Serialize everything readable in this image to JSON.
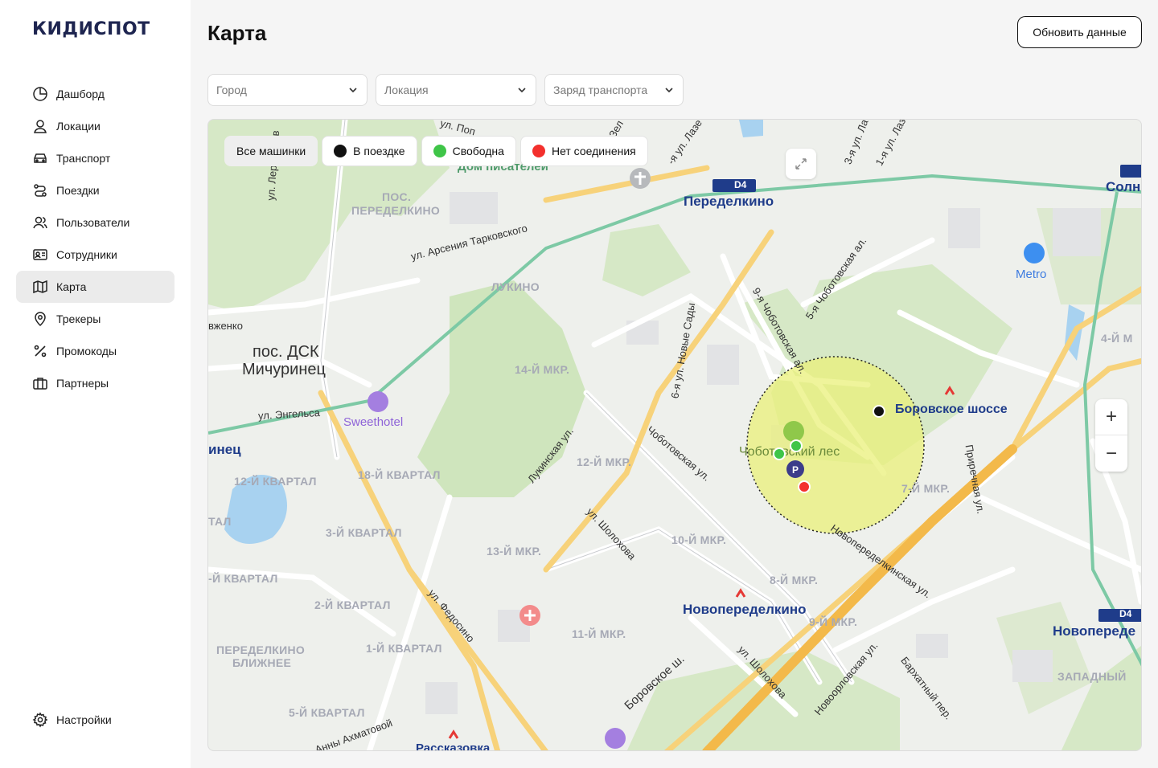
{
  "app": {
    "logo": "КИДИСПОТ"
  },
  "sidebar": {
    "items": [
      {
        "label": "Дашборд",
        "icon": "dashboard-icon"
      },
      {
        "label": "Локации",
        "icon": "location-user-icon"
      },
      {
        "label": "Транспорт",
        "icon": "car-icon"
      },
      {
        "label": "Поездки",
        "icon": "route-icon"
      },
      {
        "label": "Пользователи",
        "icon": "users-icon"
      },
      {
        "label": "Сотрудники",
        "icon": "id-card-icon"
      },
      {
        "label": "Карта",
        "icon": "map-icon",
        "active": true
      },
      {
        "label": "Трекеры",
        "icon": "pin-icon"
      },
      {
        "label": "Промокоды",
        "icon": "percent-icon"
      },
      {
        "label": "Партнеры",
        "icon": "briefcase-icon"
      }
    ],
    "settings": "Настройки"
  },
  "header": {
    "title": "Карта",
    "refresh_label": "Обновить данные"
  },
  "filters": {
    "city": "Город",
    "location": "Локация",
    "charge": "Заряд транспорта"
  },
  "legend": {
    "all": "Все машинки",
    "in_trip": "В поездке",
    "free": "Свободна",
    "no_connection": "Нет соединения"
  },
  "colors": {
    "in_trip": "#111111",
    "free": "#3fc548",
    "no_connection": "#f3302d",
    "geofence": "#e9f07a"
  },
  "map": {
    "places": {
      "peredelkino": "Переделкино",
      "novoperedelkino": "Новопеределкино",
      "novopered_right": "Новопереде",
      "borovskoe": "Боровское шоссе",
      "solnts": "Солн",
      "metro": "Metro",
      "sweethotel": "Sweethotel",
      "dom_pisateley": "Дом писателей",
      "mich_left": "инец",
      "rasskazovka": "Рассказовка",
      "chobot_forest": "Чоботовский лес",
      "d4": "D4"
    },
    "towns": {
      "dsk": "пос. ДСК",
      "dsk2": "Мичуринец"
    },
    "districts": {
      "pos_peredelkino": "ПОС.",
      "pos_peredelkino2": "ПЕРЕДЕЛКИНО",
      "lukino": "ЛУКИНО",
      "m14": "14-Й МКР.",
      "m12": "12-Й МКР.",
      "m13": "13-Й МКР.",
      "m10": "10-Й МКР.",
      "m11": "11-Й МКР.",
      "m8": "8-Й МКР.",
      "m9": "9-Й МКР.",
      "m7": "7-Й МКР.",
      "m4": "4-Й М",
      "q12": "12-Й КВАРТАЛ",
      "q18": "18-Й КВАРТАЛ",
      "q3": "3-Й КВАРТАЛ",
      "q2": "2-Й КВАРТАЛ",
      "q1": "1-Й КВАРТАЛ",
      "q5": "5-Й КВАРТАЛ",
      "q_left": "-Й КВАРТАЛ",
      "tal": "ТАЛ",
      "blizh1": "ПЕРЕДЕЛКИНО",
      "blizh2": "БЛИЖНЕЕ",
      "zapad": "ЗАПАДНЫЙ"
    },
    "streets": {
      "arseniya": "ул. Арсения Тарковского",
      "engelsa": "ул. Энгельса",
      "lermontov": "ул. Лермонтов",
      "lukinskaya": "Лукинская ул.",
      "chobotovskaya": "Чоботовская ул.",
      "sholokhova": "ул. Шолохова",
      "sholokhova2": "ул. Шолохова",
      "fedosino": "ул. Федосино",
      "borovskoe_sh": "Боровское ш.",
      "novoperedelkinskaya": "Новопеределкинская ул.",
      "novoorlovskaya": "Новоорловская ул.",
      "barkhatny": "Бархатный пер.",
      "chobot9": "9-я Чоботовская ал.",
      "chobot5": "5-я Чоботовская ал.",
      "novye_sady": "6-я ул. Новые Сады",
      "privarnaya": "Приречная ул.",
      "akhmatovoy": "Анны Ахматовой",
      "vzhenko": "вженко",
      "ul_pop": "ул. Поп",
      "laz": "-я ул. Лазе",
      "la3": "3-я ул. Ла",
      "la1": "1-я ул. Лаз",
      "zel": "Зел"
    },
    "zoom_in": "+",
    "zoom_out": "−",
    "markers": [
      {
        "status": "in_trip"
      },
      {
        "status": "free"
      },
      {
        "status": "free"
      },
      {
        "status": "no_connection"
      }
    ]
  }
}
